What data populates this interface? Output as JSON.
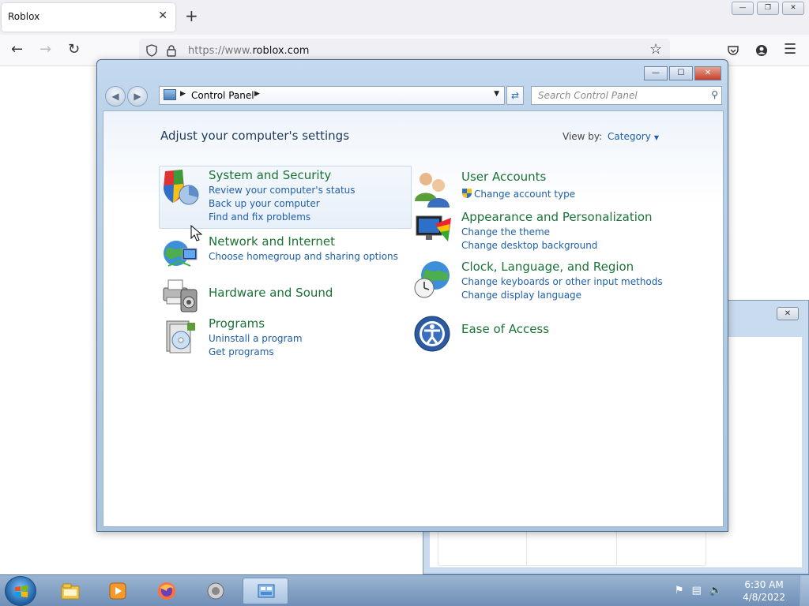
{
  "browser": {
    "tab_title": "Roblox",
    "tab_close": "✕",
    "new_tab": "+",
    "url_prefix": "https://www.",
    "url_domain": "roblox.com",
    "window_buttons": [
      "—",
      "❐",
      "✕"
    ]
  },
  "control_panel": {
    "breadcrumb": "Control Panel",
    "search_placeholder": "Search Control Panel",
    "heading": "Adjust your computer's settings",
    "view_by_label": "View by:",
    "view_by_value": "Category",
    "categories": [
      {
        "title": "System and Security",
        "links": [
          "Review your computer's status",
          "Back up your computer",
          "Find and fix problems"
        ],
        "icon": "shield-icon"
      },
      {
        "title": "Network and Internet",
        "links": [
          "Choose homegroup and sharing options"
        ],
        "icon": "globe-network-icon"
      },
      {
        "title": "Hardware and Sound",
        "links": [],
        "icon": "printer-speaker-icon"
      },
      {
        "title": "Programs",
        "links": [
          "Uninstall a program",
          "Get programs"
        ],
        "icon": "programs-icon"
      },
      {
        "title": "User Accounts",
        "links": [
          "Change account type"
        ],
        "icon": "users-icon"
      },
      {
        "title": "Appearance and Personalization",
        "links": [
          "Change the theme",
          "Change desktop background"
        ],
        "icon": "monitor-paint-icon"
      },
      {
        "title": "Clock, Language, and Region",
        "links": [
          "Change keyboards or other input methods",
          "Change display language"
        ],
        "icon": "globe-clock-icon"
      },
      {
        "title": "Ease of Access",
        "links": [],
        "icon": "ease-of-access-icon"
      }
    ]
  },
  "taskbar": {
    "time": "6:30 AM",
    "date": "4/8/2022",
    "pinned": [
      "file-explorer-icon",
      "media-player-icon",
      "firefox-icon",
      "speaker-icon",
      "control-panel-icon"
    ]
  },
  "colors": {
    "category_title": "#1a7336",
    "link": "#1f5fa7",
    "heading": "#1e395b"
  }
}
